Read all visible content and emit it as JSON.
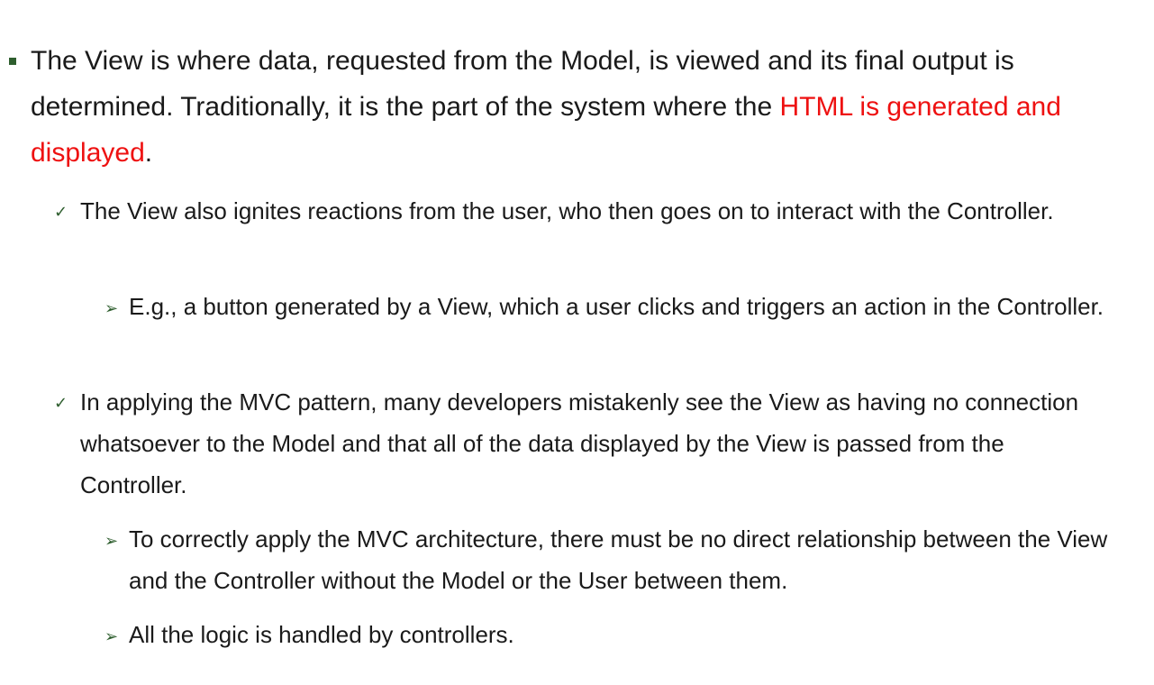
{
  "slide": {
    "point1": {
      "text_before": "The View is where data, requested from the Model, is viewed and its final output is determined. Traditionally, it is the part of the system where the ",
      "highlight": "HTML is generated and displayed",
      "text_after": ".",
      "highlight_color": "#ee1111"
    },
    "point1_sub1": {
      "text": "The View also ignites reactions from the user, who then goes on to interact with the Controller."
    },
    "point1_sub1_detail1": {
      "text": "E.g., a button generated by a View, which a user clicks and triggers an action in the Controller."
    },
    "point1_sub2": {
      "text": "In applying the MVC pattern, many developers mistakenly see the View as having no connection whatsoever to the Model and that all of the data displayed by the View is passed from the Controller."
    },
    "point1_sub2_detail1": {
      "text": "To correctly apply the MVC architecture, there must be no direct relationship between the View and the Controller without the Model or the User between them."
    },
    "point1_sub2_detail2": {
      "text": "All the logic is handled by controllers."
    },
    "bullet_symbols": {
      "check": "✓",
      "arrow": "➢"
    },
    "colors": {
      "bullet": "#2e5e2e",
      "text": "#1a1a1a"
    }
  }
}
